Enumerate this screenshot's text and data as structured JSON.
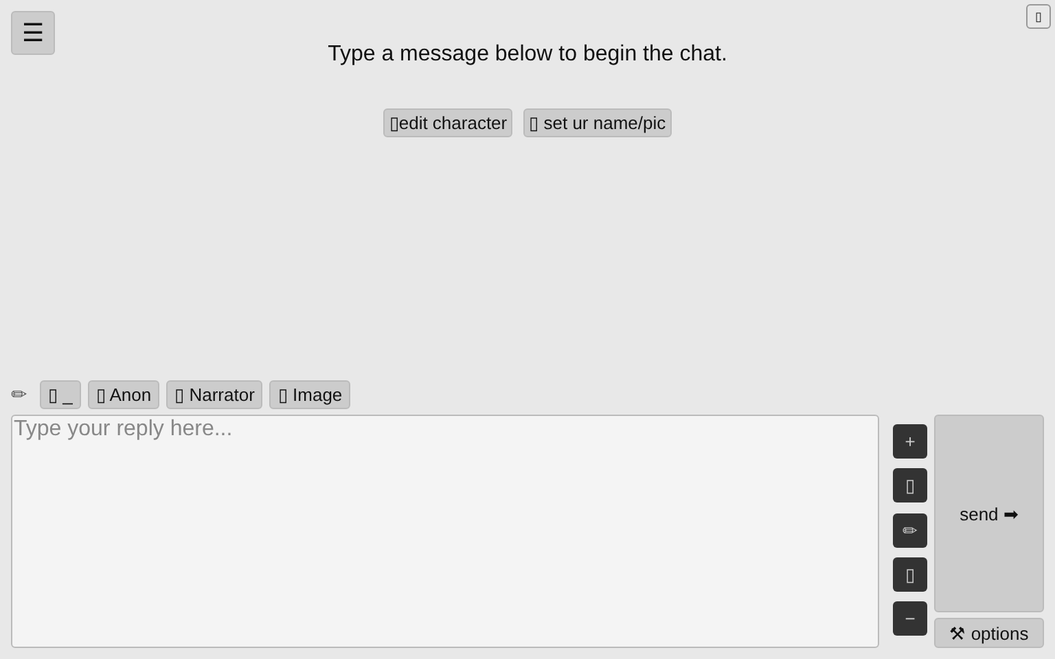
{
  "menu_button": "☰",
  "corner_button": "▯",
  "intro": "Type a message below to begin the chat.",
  "actions": [
    "▯edit character",
    "▯ set ur name/pic"
  ],
  "character_bar": {
    "icon": "✏",
    "characters": [
      "▯ _",
      "▯ Anon",
      "▯ Narrator",
      "▯ Image"
    ]
  },
  "reply": {
    "placeholder": "Type your reply here..."
  },
  "side_buttons": [
    "+",
    "▯",
    "✏",
    "▯",
    "−"
  ],
  "send_button": "send ➡",
  "options_button": "⚒ options"
}
